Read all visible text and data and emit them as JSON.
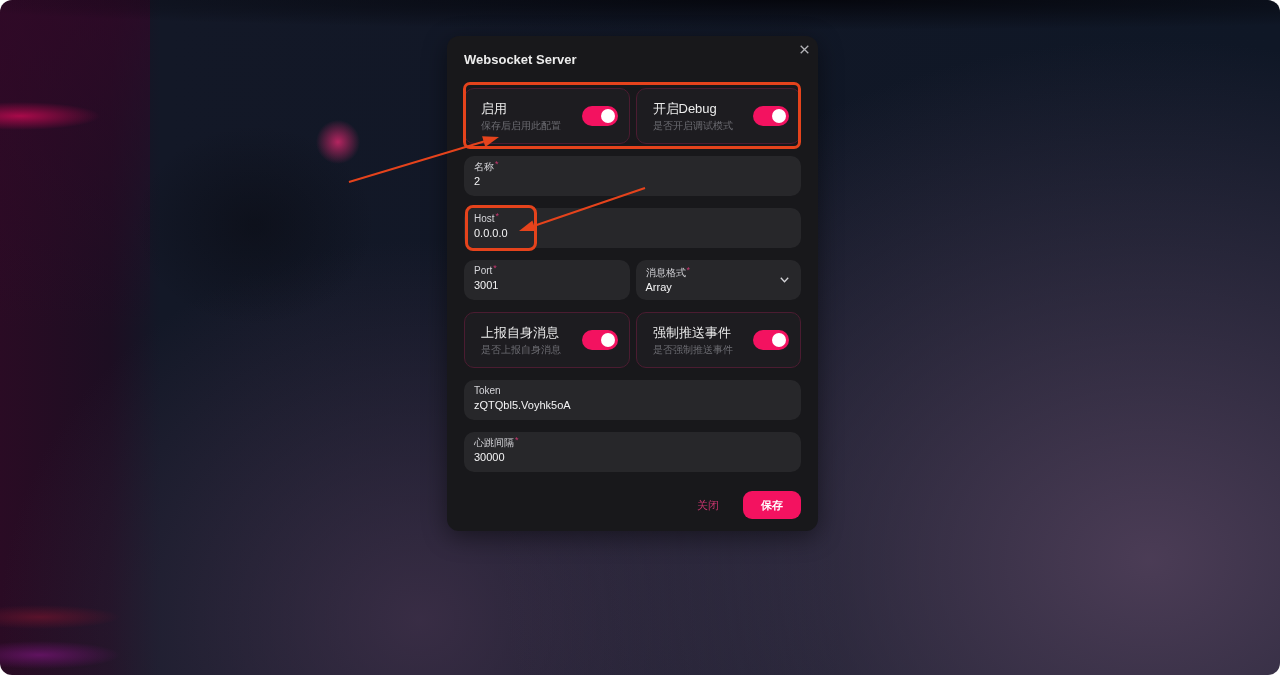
{
  "dialog": {
    "title": "Websocket Server",
    "rows": [
      {
        "highlighted": true,
        "items": [
          {
            "kind": "toggle",
            "label": "启用",
            "hint": "保存后启用此配置",
            "on": true
          },
          {
            "kind": "toggle",
            "label": "开启Debug",
            "hint": "是否开启调试模式",
            "on": true
          }
        ]
      },
      {
        "highlighted": false,
        "items": [
          {
            "kind": "text",
            "label": "名称$^{*}$",
            "value": "2"
          }
        ]
      },
      {
        "highlighted": true,
        "items": [
          {
            "kind": "text",
            "label": "Host$^{*}$",
            "value": "0.0.0.0"
          }
        ]
      },
      {
        "highlighted": false,
        "items": [
          {
            "kind": "text",
            "label": "Port$^{*}$",
            "value": "3001"
          },
          {
            "kind": "select",
            "label": "消息格式$^{*}$",
            "value": "Array"
          }
        ]
      },
      {
        "highlighted": false,
        "items": [
          {
            "kind": "toggle",
            "label": "上报自身消息",
            "hint": "是否上报自身消息",
            "on": true
          },
          {
            "kind": "toggle",
            "label": "强制推送事件",
            "hint": "是否强制推送事件",
            "on": true
          }
        ]
      },
      {
        "highlighted": false,
        "items": [
          {
            "kind": "text",
            "label": "Token",
            "value": "zQTQbl5.Voyhk5oA"
          }
        ]
      },
      {
        "highlighted": false,
        "items": [
          {
            "kind": "text",
            "label": "心跳间隔$^{*}$",
            "value": "30000"
          }
        ]
      }
    ],
    "buttons": [
      {
        "kind": "link",
        "label": "关闭"
      },
      {
        "kind": "primary",
        "label": "保存"
      }
    ]
  }
}
